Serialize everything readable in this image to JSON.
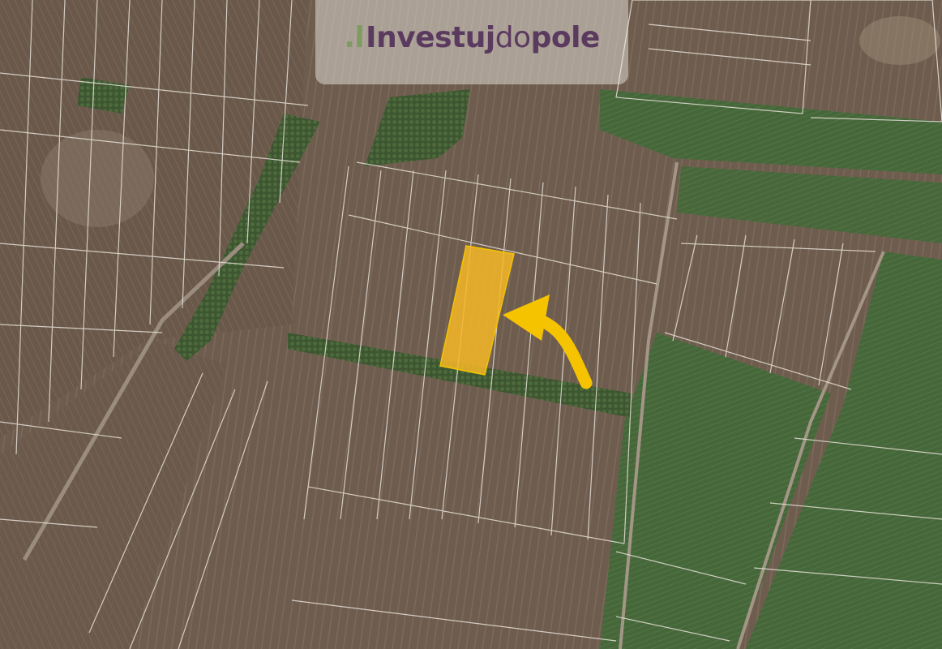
{
  "logo": {
    "mark": ".l",
    "part1": "Investuj",
    "part2": "do",
    "part3": "pole"
  },
  "map": {
    "highlighted_parcel_color": "#f6b727",
    "arrow_color": "#f6c300",
    "parcel_line_color": "#e6e0d8",
    "icons": [
      "arrow-pointer-icon"
    ]
  }
}
